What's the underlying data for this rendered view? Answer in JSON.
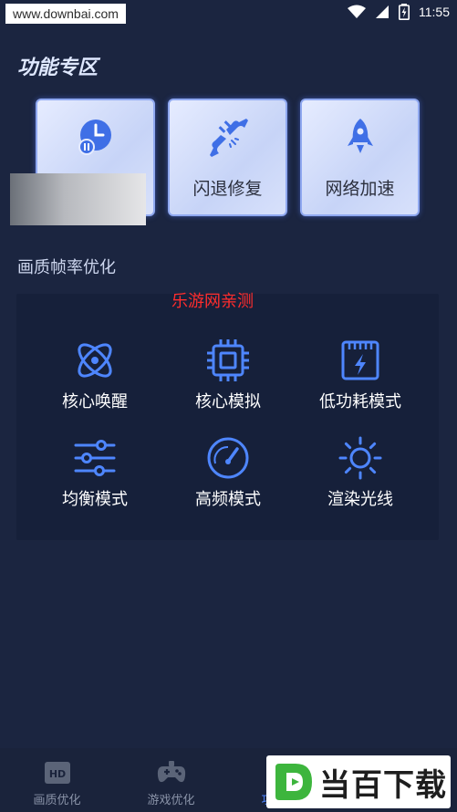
{
  "status_bar": {
    "watermark_url": "www.downbai.com",
    "time": "11:55",
    "icons": [
      "wifi-icon",
      "signal-icon",
      "battery-icon"
    ]
  },
  "section": {
    "title": "功能专区"
  },
  "feature_cards": [
    {
      "label": "",
      "icon": "clock-icon"
    },
    {
      "label": "闪退修复",
      "icon": "plug-icon"
    },
    {
      "label": "网络加速",
      "icon": "rocket-icon"
    }
  ],
  "sub_section": {
    "title": "画质帧率优化"
  },
  "panel_watermark": "乐游网亲测",
  "modes": [
    {
      "label": "核心唤醒",
      "icon": "atom-icon"
    },
    {
      "label": "核心模拟",
      "icon": "chip-icon"
    },
    {
      "label": "低功耗模式",
      "icon": "battery-bolt-icon"
    },
    {
      "label": "均衡模式",
      "icon": "sliders-icon"
    },
    {
      "label": "高频模式",
      "icon": "speedometer-icon"
    },
    {
      "label": "渲染光线",
      "icon": "sun-icon"
    }
  ],
  "bottom_nav": {
    "items": [
      {
        "label": "画质优化",
        "icon": "hd-icon"
      },
      {
        "label": "游戏优化",
        "icon": "gamepad-icon"
      },
      {
        "label": "功能专区",
        "icon": "grid-icon"
      },
      {
        "label": "",
        "icon": "user-icon"
      }
    ],
    "active_index": 2
  },
  "colors": {
    "background": "#1b2540",
    "panel": "#16203a",
    "accent": "#4e86ff",
    "watermark_red": "#ff2d2d"
  },
  "corner_logo": {
    "text": "当百下载"
  }
}
